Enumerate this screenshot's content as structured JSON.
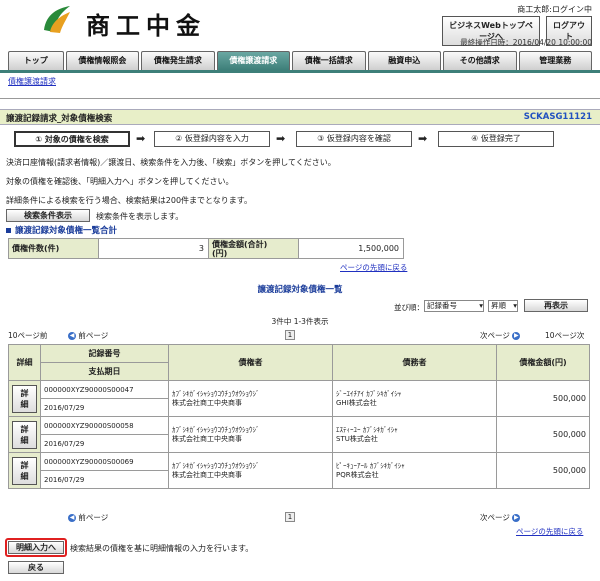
{
  "header": {
    "brand": "商工中金",
    "user": "商工太郎:ログイン中",
    "biz_button": "ビジネスWebトップページへ",
    "logout_button": "ログアウト",
    "last_op": "最終操作日時：2016/04/20 10:00:00"
  },
  "tabs": [
    "トップ",
    "債権情報照会",
    "債権発生請求",
    "債権譲渡請求",
    "債権一括請求",
    "融資申込",
    "その他請求",
    "管理業務"
  ],
  "breadcrumb": "債権譲渡請求",
  "page": {
    "title": "譲渡記録請求_対象債権検索",
    "code": "SCKASG11121"
  },
  "steps": [
    "① 対象の債権を検索",
    "② 仮登録内容を入力",
    "③ 仮登録内容を確認",
    "④ 仮登録完了"
  ],
  "messages": [
    "決済口座情報(請求者情報)／譲渡日、検索条件を入力後、「検索」ボタンを押してください。",
    "対象の債権を確認後、「明細入力へ」ボタンを押してください。",
    "詳細条件による検索を行う場合、検索結果は200件までとなります。"
  ],
  "search_toggle": {
    "button": "検索条件表示",
    "note": "検索条件を表示します。"
  },
  "summary": {
    "section": "譲渡記録対象債権一覧合計",
    "count_label": "債権件数(件)",
    "count_value": "3",
    "amount_label": "債権金額(合計)\n(円)",
    "amount_value": "1,500,000",
    "top_link": "ページの先頭に戻る"
  },
  "list": {
    "title": "譲渡記録対象債権一覧",
    "sort_label": "並び順：",
    "sort_field": "記録番号",
    "sort_order": "昇順",
    "sort_button": "再表示",
    "result_count": "3件中 1-3件表示",
    "prev10": "10ページ前",
    "prev": "前ページ",
    "next": "次ページ",
    "next10": "10ページ次",
    "page": "1",
    "headers": {
      "detail": "詳細",
      "record_no": "記録番号",
      "due": "支払期日",
      "creditor": "債権者",
      "debtor": "債務者",
      "amount": "債権金額(円)"
    },
    "detail_button": "詳細",
    "rows": [
      {
        "record_no": "000000XYZ90000S00047",
        "due": "2016/07/29",
        "creditor_kana": "ｶﾌﾞｼｷｶﾞｲｼｬｼｮｳｺｳﾁｭｳｵｳｼｮｳｼﾞ",
        "creditor": "株式会社商工中央商事",
        "debtor_kana": "ｼﾞｰｴｲﾁｱｲ ｶﾌﾞｼｷｶﾞｲｼｬ",
        "debtor": "GHI株式会社",
        "amount": "500,000"
      },
      {
        "record_no": "000000XYZ90000S00058",
        "due": "2016/07/29",
        "creditor_kana": "ｶﾌﾞｼｷｶﾞｲｼｬｼｮｳｺｳﾁｭｳｵｳｼｮｳｼﾞ",
        "creditor": "株式会社商工中央商事",
        "debtor_kana": "ｴｽﾃｨｰﾕｰ ｶﾌﾞｼｷｶﾞｲｼｬ",
        "debtor": "STU株式会社",
        "amount": "500,000"
      },
      {
        "record_no": "000000XYZ90000S00069",
        "due": "2016/07/29",
        "creditor_kana": "ｶﾌﾞｼｷｶﾞｲｼｬｼｮｳｺｳﾁｭｳｵｳｼｮｳｼﾞ",
        "creditor": "株式会社商工中央商事",
        "debtor_kana": "ﾋﾟｰｷｭｰｱｰﾙ ｶﾌﾞｼｷｶﾞｲｼｬ",
        "debtor": "PQR株式会社",
        "amount": "500,000"
      }
    ],
    "top_link": "ページの先頭に戻る"
  },
  "footer": {
    "detail_input_button": "明細入力へ",
    "detail_input_note": "検索結果の債権を基に明細情報の入力を行います。",
    "back_button": "戻る"
  }
}
